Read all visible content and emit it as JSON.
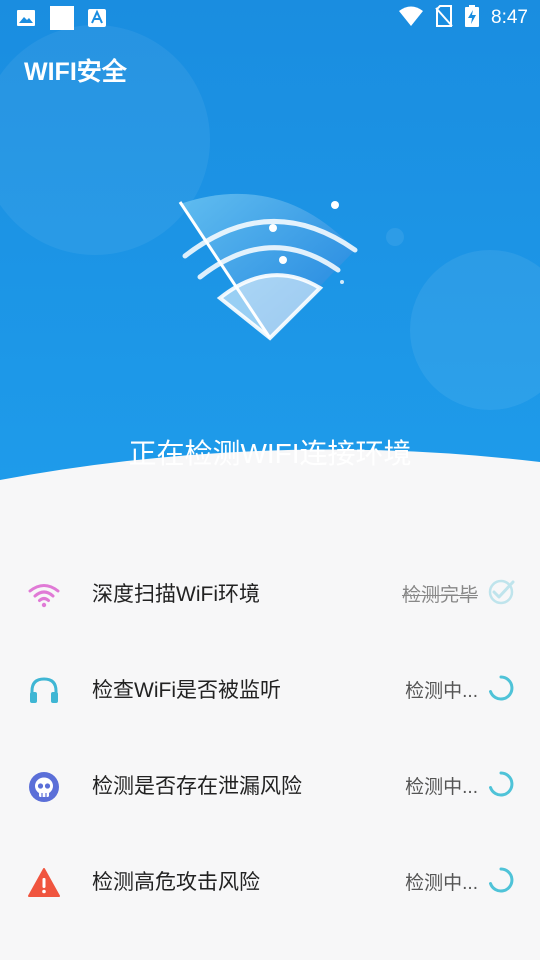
{
  "status_bar": {
    "time": "8:47",
    "left_icons": [
      "image-icon",
      "square-icon",
      "font-icon"
    ],
    "right_icons": [
      "wifi-signal-icon",
      "no-sim-icon",
      "battery-charging-icon"
    ]
  },
  "header": {
    "title": "WIFI安全",
    "scan_status": "正在检测WIFI连接环境"
  },
  "colors": {
    "hero_blue": "#1a8ee0",
    "accent_cyan": "#4fc3d8",
    "wifi_pink": "#e07ad6",
    "headset_cyan": "#3fb6d4",
    "skull_purple": "#5b6fd8",
    "warning_red": "#f0553f"
  },
  "checks": [
    {
      "icon": "wifi-icon",
      "label": "深度扫描WiFi环境",
      "status": "检测完毕",
      "state": "done"
    },
    {
      "icon": "headset-icon",
      "label": "检查WiFi是否被监听",
      "status": "检测中...",
      "state": "loading"
    },
    {
      "icon": "skull-icon",
      "label": "检测是否存在泄漏风险",
      "status": "检测中...",
      "state": "loading"
    },
    {
      "icon": "warning-icon",
      "label": "检测高危攻击风险",
      "status": "检测中...",
      "state": "loading"
    }
  ]
}
